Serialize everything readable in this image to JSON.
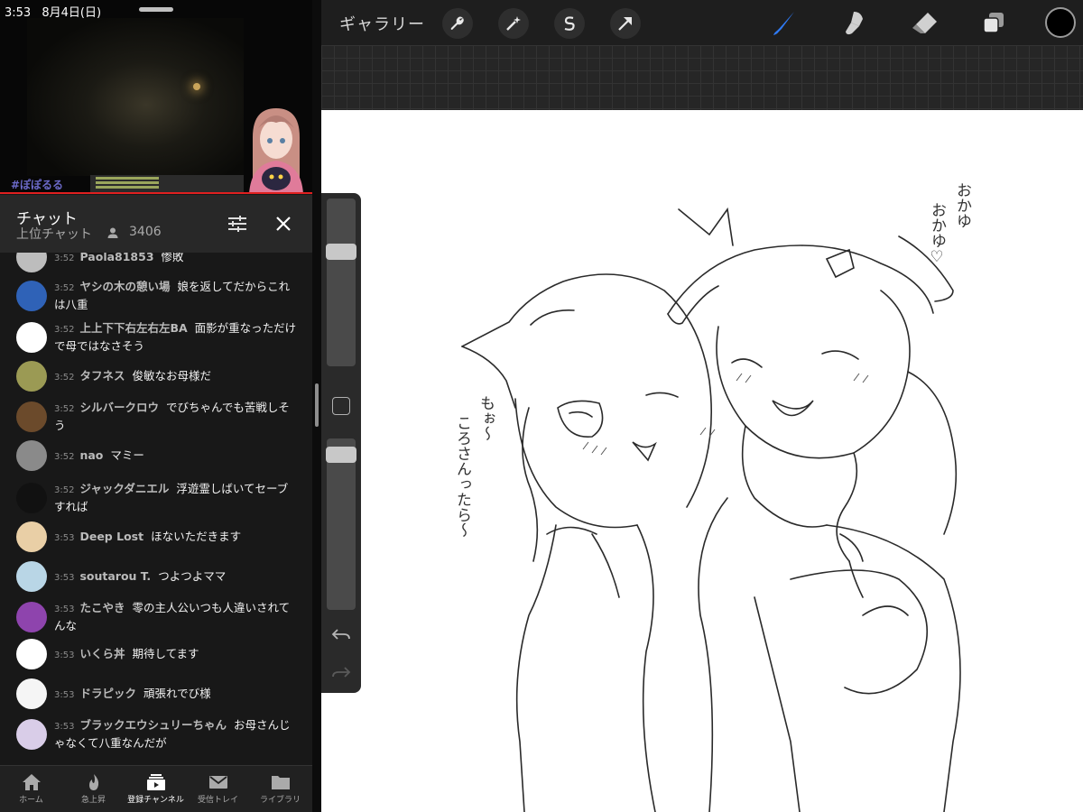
{
  "status_bar": {
    "time": "3:53",
    "date": "8月4日(日)"
  },
  "video": {
    "caption": "#ぽぽるる"
  },
  "chat_header": {
    "title": "チャット",
    "subtitle": "上位チャット",
    "viewer_count": "3406"
  },
  "messages": [
    {
      "time": "3:52",
      "author": "Paola81853",
      "text": "惨敗",
      "avatar": "#bdbdbd"
    },
    {
      "time": "3:52",
      "author": "ヤシの木の憩い場",
      "text": "娘を返してだからこれは八重",
      "avatar": "#2f62b7"
    },
    {
      "time": "3:52",
      "author": "上上下下右左右左BA",
      "text": "面影が重なっただけで母ではなさそう",
      "avatar": "#ffffff"
    },
    {
      "time": "3:52",
      "author": "タフネス",
      "text": "俊敏なお母様だ",
      "avatar": "#9b9a54"
    },
    {
      "time": "3:52",
      "author": "シルバークロウ",
      "text": "でびちゃんでも苦戦しそう",
      "avatar": "#6b4a2b"
    },
    {
      "time": "3:52",
      "author": "nao",
      "text": "マミー",
      "avatar": "#8a8a8a"
    },
    {
      "time": "3:52",
      "author": "ジャックダニエル",
      "text": "浮遊霊しばいてセーブすれば",
      "avatar": "#111111"
    },
    {
      "time": "3:53",
      "author": "Deep Lost",
      "text": "ほないただきます",
      "avatar": "#e9cfa6"
    },
    {
      "time": "3:53",
      "author": "soutarou T.",
      "text": "つよつよママ",
      "avatar": "#b9d6e6"
    },
    {
      "time": "3:53",
      "author": "たこやき",
      "text": "零の主人公いつも人違いされてんな",
      "avatar": "#8e44ad"
    },
    {
      "time": "3:53",
      "author": "いくら丼",
      "text": "期待してます",
      "avatar": "#ffffff"
    },
    {
      "time": "3:53",
      "author": "ドラピック",
      "text": "頑張れでび様",
      "avatar": "#f5f5f5"
    },
    {
      "time": "3:53",
      "author": "ブラックエウシュリーちゃん",
      "text": "お母さんじゃなくて八重なんだが",
      "avatar": "#d9cde8"
    }
  ],
  "bottom_nav": [
    {
      "label": "ホーム",
      "icon": "home-icon"
    },
    {
      "label": "急上昇",
      "icon": "flame-icon"
    },
    {
      "label": "登録チャンネル",
      "icon": "subscriptions-icon"
    },
    {
      "label": "受信トレイ",
      "icon": "inbox-icon"
    },
    {
      "label": "ライブラリ",
      "icon": "library-icon"
    }
  ],
  "procreate": {
    "gallery_label": "ギャラリー",
    "tools_left": [
      "wrench-icon",
      "magic-wand-icon",
      "selection-icon",
      "transform-arrow-icon"
    ],
    "tools_right": [
      "brush-icon",
      "smudge-icon",
      "eraser-icon",
      "layers-icon"
    ],
    "active_tool": "brush-icon",
    "accent_color": "#2f7bf6",
    "current_color": "#000000",
    "brush_size_level": 0.7,
    "opacity_level": 0.95
  },
  "drawing_text": {
    "note_right_1": "おかゆ",
    "note_right_2": "おかゆ♡",
    "note_left_1": "もぉ～",
    "note_left_2": "ころさんったら～"
  }
}
